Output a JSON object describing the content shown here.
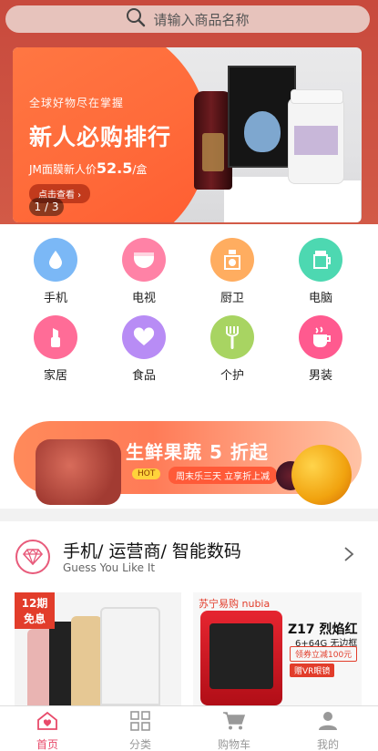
{
  "search": {
    "placeholder": "请输入商品名称"
  },
  "banner": {
    "line1": "全球好物尽在掌握",
    "line2": "新人必购排行",
    "line3_prefix": "JM面膜新人价",
    "line3_price": "52.5",
    "line3_suffix": "/盒",
    "cta": "点击查看 ›",
    "pager": "1 / 3"
  },
  "categories": [
    {
      "label": "手机",
      "icon": "drop-icon",
      "color": "#7bb8f6"
    },
    {
      "label": "电视",
      "icon": "diaper-icon",
      "color": "#ff82a6"
    },
    {
      "label": "厨卫",
      "icon": "jar-icon",
      "color": "#ffad60"
    },
    {
      "label": "电脑",
      "icon": "cup-icon",
      "color": "#4dd8b1"
    },
    {
      "label": "家居",
      "icon": "lipstick-icon",
      "color": "#ff6c97"
    },
    {
      "label": "食品",
      "icon": "heart-icon",
      "color": "#b88cf5"
    },
    {
      "label": "个护",
      "icon": "fork-icon",
      "color": "#a8d462"
    },
    {
      "label": "男装",
      "icon": "cup-steam-icon",
      "color": "#ff5a8f"
    }
  ],
  "promo": {
    "title": "生鲜果蔬 5 折起",
    "hot": "HOT",
    "subtitle": "周末乐三天 立享折上减"
  },
  "recommend": {
    "title": "手机/ 运营商/ 智能数码",
    "subtitle": "Guess You Like It",
    "card1": {
      "tag_top": "12期",
      "tag_bottom": "免息"
    },
    "card2": {
      "brand": "苏宁易购 nubia",
      "model": "Z17 烈焰红",
      "spec": "6+64G 无边框",
      "chip1": "领券立减100元",
      "chip2": "赠VR眼镜"
    }
  },
  "tabs": [
    {
      "label": "首页",
      "icon": "home-icon",
      "active": true
    },
    {
      "label": "分类",
      "icon": "grid-icon",
      "active": false
    },
    {
      "label": "购物车",
      "icon": "cart-icon",
      "active": false
    },
    {
      "label": "我的",
      "icon": "user-icon",
      "active": false
    }
  ],
  "colors": {
    "accent": "#e84a6a",
    "header": "#c84a3d",
    "promo": "#ff7b57"
  }
}
